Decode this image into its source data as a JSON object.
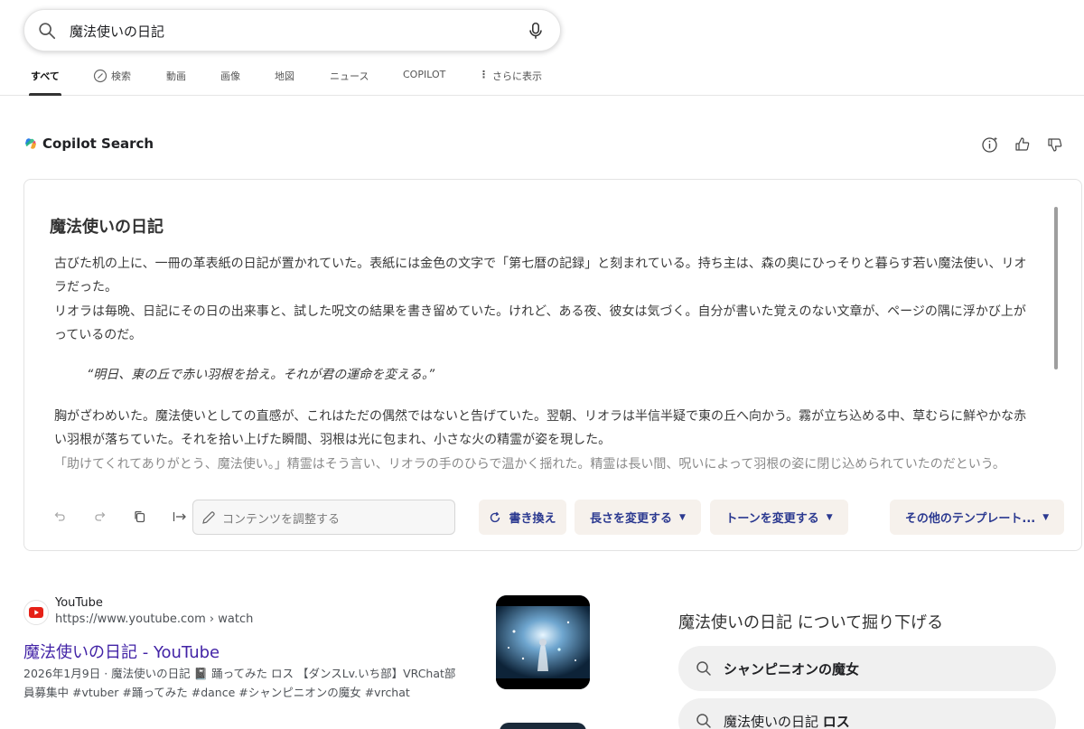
{
  "search": {
    "query": "魔法使いの日記"
  },
  "tabs": [
    {
      "label": "すべて"
    },
    {
      "label": "検索"
    },
    {
      "label": "動画"
    },
    {
      "label": "画像"
    },
    {
      "label": "地図"
    },
    {
      "label": "ニュース"
    },
    {
      "label": "COPILOT"
    },
    {
      "label": "さらに表示"
    }
  ],
  "copilot": {
    "brand": "Copilot Search",
    "card_title": "魔法使いの日記",
    "paragraphs": [
      "古びた机の上に、一冊の革表紙の日記が置かれていた。表紙には金色の文字で「第七暦の記録」と刻まれている。持ち主は、森の奥にひっそりと暮らす若い魔法使い、リオラだった。",
      "リオラは毎晩、日記にその日の出来事と、試した呪文の結果を書き留めていた。けれど、ある夜、彼女は気づく。自分が書いた覚えのない文章が、ページの隅に浮かび上がっているのだ。",
      "“明日、東の丘で赤い羽根を拾え。それが君の運命を変える。”",
      "胸がざわめいた。魔法使いとしての直感が、これはただの偶然ではないと告げていた。翌朝、リオラは半信半疑で東の丘へ向かう。霧が立ち込める中、草むらに鮮やかな赤い羽根が落ちていた。それを拾い上げた瞬間、羽根は光に包まれ、小さな火の精霊が姿を現した。",
      "「助けてくれてありがとう、魔法使い。」精霊はそう言い、リオラの手のひらで温かく揺れた。精霊は長い間、呪いによって羽根の姿に閉じ込められていたのだという。"
    ],
    "toolbar": {
      "adjust_placeholder": "コンテンツを調整する",
      "rewrite": "書き換え",
      "length": "長さを変更する",
      "tone": "トーンを変更する",
      "templates": "その他のテンプレート..."
    }
  },
  "result": {
    "site": "YouTube",
    "url": "https://www.youtube.com › watch",
    "title": "魔法使いの日記 - YouTube",
    "snippet_line1": "2026年1月9日 · 魔法使いの日記 📓 踊ってみた ロス 【ダンスLv.いち部】VRChat部",
    "snippet_line2": "員募集中 #vtuber #踊ってみた #dance #シャンピニオンの魔女 #vrchat"
  },
  "dig": {
    "title": "魔法使いの日記 について掘り下げる",
    "suggestions": [
      {
        "prefix": "",
        "bold": "シャンピニオンの魔女"
      },
      {
        "prefix": "魔法使いの日記 ",
        "bold": "ロス"
      }
    ]
  },
  "colors": {
    "link": "#4223a6",
    "accent": "#2b3990",
    "pill_bg": "#f6f1ec"
  }
}
